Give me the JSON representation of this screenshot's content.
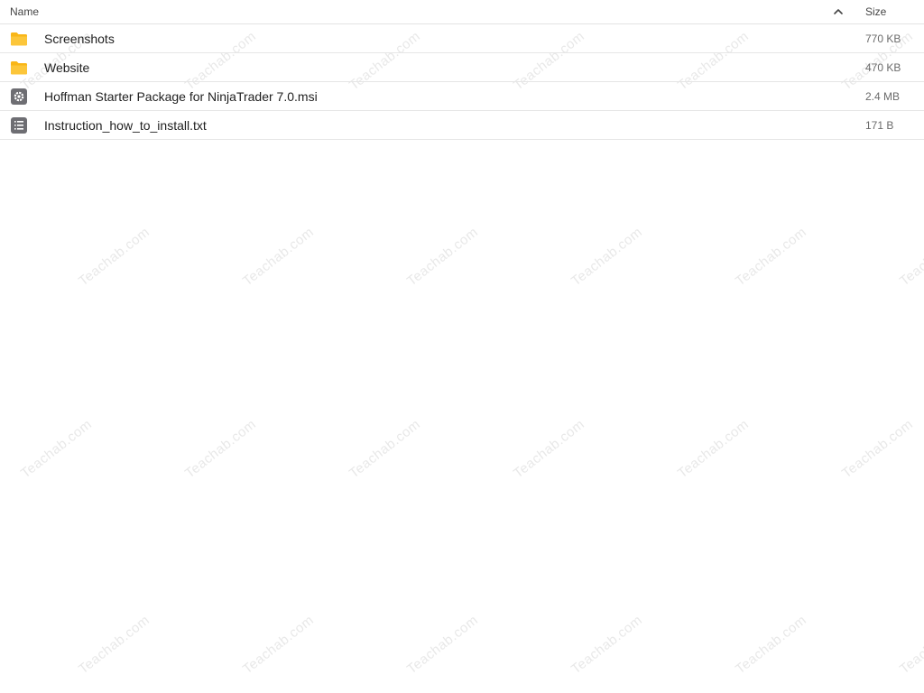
{
  "header": {
    "name_label": "Name",
    "size_label": "Size",
    "sort_icon": "chevron-up-icon"
  },
  "files": [
    {
      "name": "Screenshots",
      "size": "770 KB",
      "icon": "folder-icon"
    },
    {
      "name": "Website",
      "size": "470 KB",
      "icon": "folder-icon"
    },
    {
      "name": "Hoffman Starter Package for NinjaTrader 7.0.msi",
      "size": "2.4 MB",
      "icon": "installer-gear-icon"
    },
    {
      "name": "Instruction_how_to_install.txt",
      "size": "171 B",
      "icon": "text-file-icon"
    }
  ],
  "watermark_text": "Teachab.com",
  "colors": {
    "folder": "#f9b617",
    "file_icon": "#6e6e73",
    "divider": "#e6e6e6"
  }
}
